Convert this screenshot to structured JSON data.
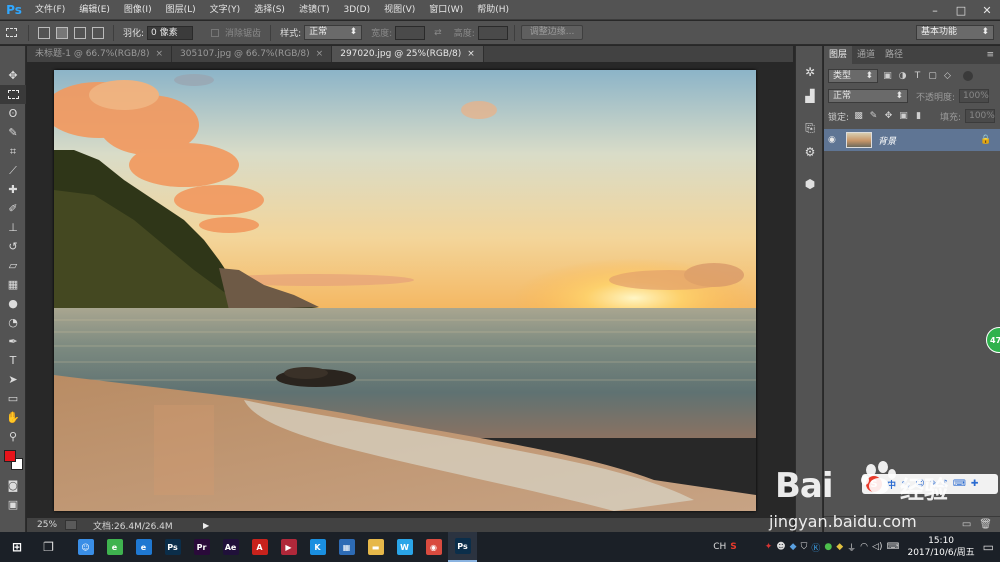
{
  "app": {
    "logo": "Ps",
    "menus": [
      "文件(F)",
      "编辑(E)",
      "图像(I)",
      "图层(L)",
      "文字(Y)",
      "选择(S)",
      "滤镜(T)",
      "3D(D)",
      "视图(V)",
      "窗口(W)",
      "帮助(H)"
    ],
    "window_controls": [
      "–",
      "□",
      "✕"
    ]
  },
  "options_bar": {
    "feather_label": "羽化:",
    "feather_value": "0 像素",
    "antialias_label": "消除锯齿",
    "style_label": "样式:",
    "style_value": "正常",
    "width_label": "宽度:",
    "height_label": "高度:",
    "refine_edge_label": "调整边缘...",
    "workspace_value": "基本功能"
  },
  "tabs": [
    {
      "label": "未标题-1 @ 66.7%(RGB/8)",
      "active": false
    },
    {
      "label": "305107.jpg @ 66.7%(RGB/8)",
      "active": false
    },
    {
      "label": "297020.jpg @ 25%(RGB/8)",
      "active": true
    }
  ],
  "tab_close_glyph": "×",
  "status": {
    "zoom": "25%",
    "doc_info": "文档:26.4M/26.4M"
  },
  "tools": [
    "move",
    "marquee",
    "lasso",
    "quick-select",
    "crop",
    "eyedropper",
    "healing",
    "brush",
    "stamp",
    "history-brush",
    "eraser",
    "gradient",
    "blur",
    "dodge",
    "pen",
    "type",
    "path-select",
    "shape",
    "hand",
    "zoom"
  ],
  "colors": {
    "foreground": "#e8141b",
    "background": "#ffffff",
    "layer_selected": "#5f7594",
    "ps_blue": "#31a8ff"
  },
  "layers_panel": {
    "tabs": [
      "图层",
      "通道",
      "路径"
    ],
    "filter_label": "类型",
    "blend_mode": "正常",
    "opacity_label": "不透明度:",
    "opacity_value": "100%",
    "lock_label": "锁定:",
    "fill_label": "填充:",
    "fill_value": "100%",
    "layers": [
      {
        "name": "背景",
        "visible": true,
        "locked": true,
        "selected": true
      }
    ]
  },
  "taskbar": {
    "apps": [
      {
        "name": "start",
        "glyph": "⊞",
        "color": "#ffffff",
        "running": false
      },
      {
        "name": "task-view",
        "glyph": "❐",
        "color": "#dddddd",
        "running": false
      },
      {
        "name": "finder-app",
        "glyph": "☺",
        "color": "#3a8ee6",
        "running": false
      },
      {
        "name": "360-browser",
        "glyph": "e",
        "color": "#3fb34f",
        "running": false
      },
      {
        "name": "internet-explorer",
        "glyph": "e",
        "color": "#1f78d1",
        "running": false
      },
      {
        "name": "photoshop",
        "glyph": "Ps",
        "color": "#0b2e4a",
        "running": false
      },
      {
        "name": "premiere",
        "glyph": "Pr",
        "color": "#2a0a3a",
        "running": false
      },
      {
        "name": "after-effects",
        "glyph": "Ae",
        "color": "#20103a",
        "running": false
      },
      {
        "name": "acrobat",
        "glyph": "A",
        "color": "#c8221c",
        "running": false
      },
      {
        "name": "media-player",
        "glyph": "▶",
        "color": "#b0283a",
        "running": false
      },
      {
        "name": "kugou",
        "glyph": "K",
        "color": "#1a8fe0",
        "running": false
      },
      {
        "name": "calculator",
        "glyph": "▦",
        "color": "#2d6bb5",
        "running": false
      },
      {
        "name": "file-explorer",
        "glyph": "▬",
        "color": "#e6b84a",
        "running": false
      },
      {
        "name": "wps",
        "glyph": "W",
        "color": "#2aa5e8",
        "running": false
      },
      {
        "name": "chrome",
        "glyph": "◉",
        "color": "#d94b3f",
        "running": false
      },
      {
        "name": "photoshop-running",
        "glyph": "Ps",
        "color": "#0b2e4a",
        "running": true
      }
    ],
    "tray": {
      "lang": "CH",
      "time": "15:10",
      "date": "2017/10/6/周五"
    }
  },
  "watermark": {
    "brand": "Bai",
    "brand_suffix": "经验",
    "url": "jingyan.baidu.com",
    "badge": "47"
  }
}
